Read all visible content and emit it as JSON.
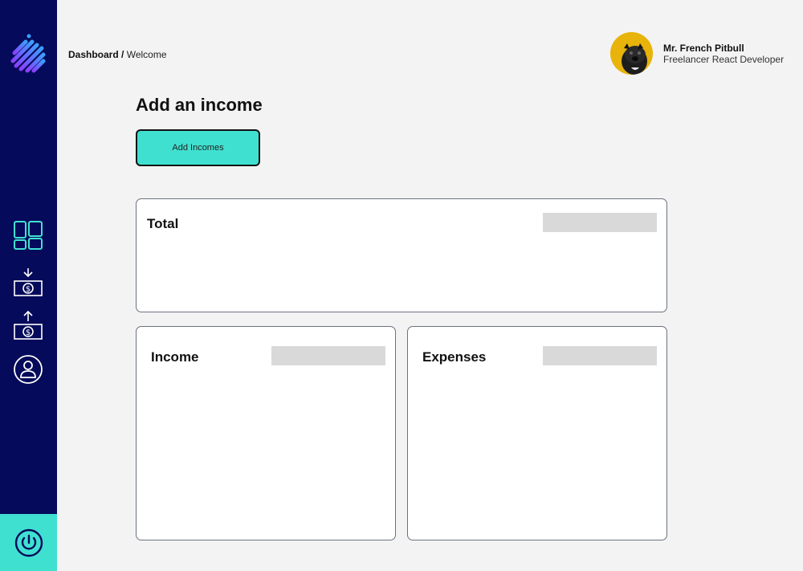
{
  "breadcrumb": {
    "section": "Dashboard",
    "separator": " / ",
    "current": "Welcome"
  },
  "user": {
    "name": "Mr. French Pitbull",
    "role": "Freelancer React Developer"
  },
  "page": {
    "title": "Add an income"
  },
  "actions": {
    "add_incomes_label": "Add Incomes"
  },
  "cards": {
    "total": {
      "title": "Total"
    },
    "income": {
      "title": "Income"
    },
    "expenses": {
      "title": "Expenses"
    }
  },
  "sidebar": {
    "items": [
      {
        "icon": "dashboard-grid-icon"
      },
      {
        "icon": "income-money-icon"
      },
      {
        "icon": "expense-money-icon"
      },
      {
        "icon": "user-profile-icon"
      }
    ],
    "footer_icon": "power-icon"
  },
  "colors": {
    "sidebar_bg": "#050a5a",
    "accent": "#40e0d0",
    "page_bg": "#f3f3f3",
    "placeholder": "#d9d9d9",
    "avatar_bg": "#e8b30a"
  }
}
